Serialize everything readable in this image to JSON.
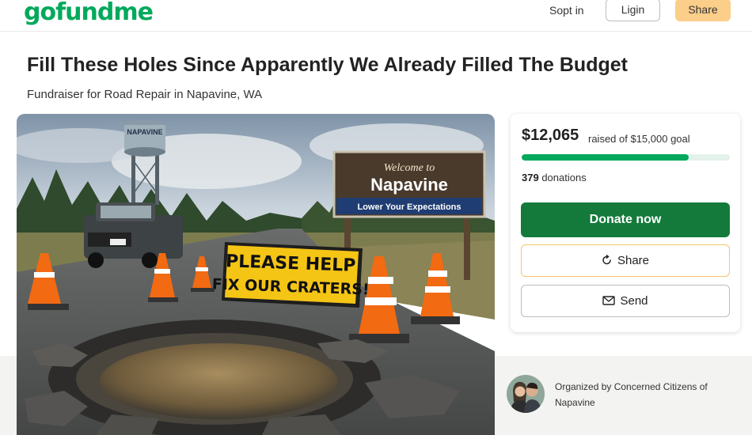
{
  "header": {
    "logo": "gofundme",
    "signin_label": "Sopt in",
    "login_label": "Ligin",
    "share_label": "Share"
  },
  "campaign": {
    "title": "Fill These Holes Since Apparently We Already Filled The Budget",
    "subtitle": "Fundraiser for Road Repair in Napavine, WA"
  },
  "hero_image": {
    "tower_text": "NAPAVINE",
    "welcome_text": "Welcome to",
    "town_text": "Napavine",
    "tagline_text": "Lower Your Expectations",
    "sign_line1": "PLEASE HELP",
    "sign_line2": "FIX OUR CRATERS!"
  },
  "donation_card": {
    "raised_amount": "$12,065",
    "raised_goal_text": "raised of $15,000 goal",
    "progress_fraction": 0.804,
    "donations_count": "379",
    "donations_label": "donations",
    "donate_label": "Donate now",
    "share_label": "Share",
    "send_label": "Send"
  },
  "organizer": {
    "text": "Organized by Concerned Citizens of Napavine"
  },
  "colors": {
    "brand_green": "#02a95c",
    "donate_green": "#147a3b",
    "share_yellow": "#fbce8a"
  }
}
